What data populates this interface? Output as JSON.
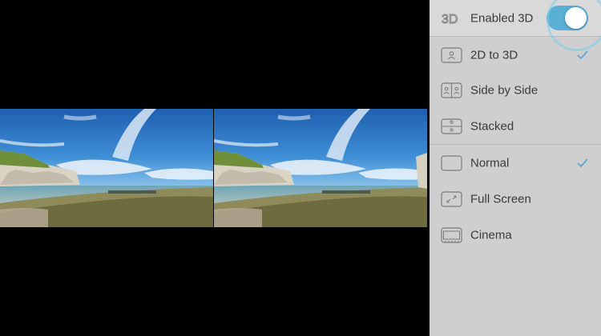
{
  "video": {
    "mode": "Side by Side"
  },
  "panel": {
    "enable_3d": {
      "icon": "3d-text-icon",
      "icon_text": "3D",
      "label": "Enabled 3D",
      "on": true,
      "accent": "#5ab0d4"
    },
    "conversion_options": [
      {
        "icon": "2d-to-3d-icon",
        "label": "2D to 3D",
        "selected": true
      },
      {
        "icon": "side-by-side-icon",
        "label": "Side by Side",
        "selected": false
      },
      {
        "icon": "stacked-icon",
        "label": "Stacked",
        "selected": false
      }
    ],
    "screen_options": [
      {
        "icon": "normal-screen-icon",
        "label": "Normal",
        "selected": true
      },
      {
        "icon": "full-screen-icon",
        "label": "Full Screen",
        "selected": false
      },
      {
        "icon": "cinema-icon",
        "label": "Cinema",
        "selected": false
      }
    ],
    "check_color": "#5aa8d8"
  }
}
